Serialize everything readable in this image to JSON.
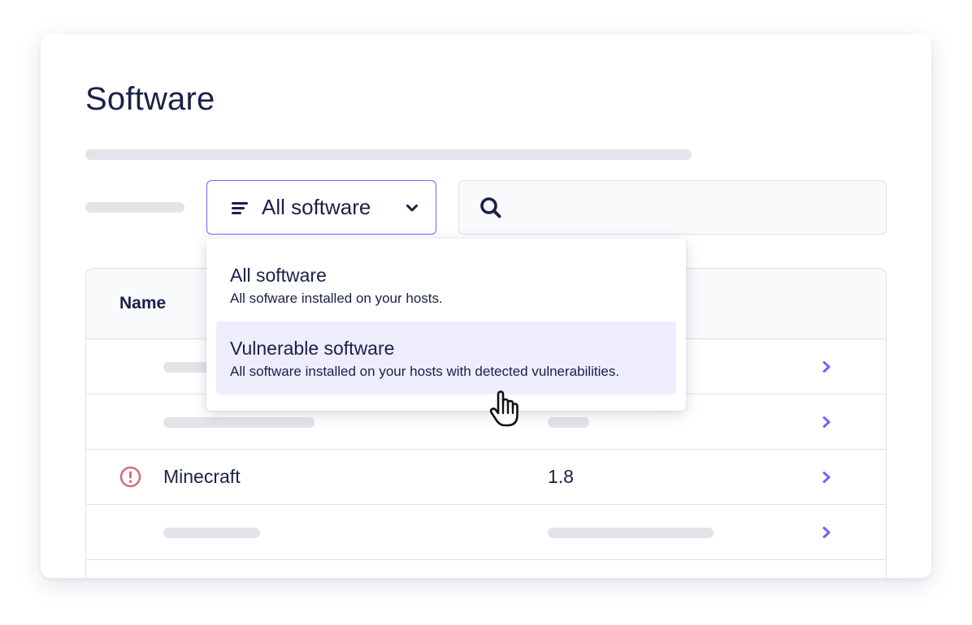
{
  "page": {
    "title": "Software"
  },
  "filter": {
    "selected_label": "All software"
  },
  "search": {
    "placeholder": ""
  },
  "table": {
    "header": {
      "name": "Name"
    },
    "rows": [
      {
        "name": "",
        "version": "",
        "placeholder": true,
        "vulnerable": false
      },
      {
        "name": "",
        "version": "",
        "placeholder": true,
        "vulnerable": false
      },
      {
        "name": "Minecraft",
        "version": "1.8",
        "placeholder": false,
        "vulnerable": true
      },
      {
        "name": "",
        "version": "",
        "placeholder": true,
        "vulnerable": false
      }
    ]
  },
  "dropdown": {
    "options": [
      {
        "title": "All software",
        "description": "All sofware installed on your hosts.",
        "highlighted": false
      },
      {
        "title": "Vulnerable software",
        "description": "All software installed on your hosts with detected vulnerabilities.",
        "highlighted": true
      }
    ]
  },
  "colors": {
    "accent": "#6a67fe",
    "text": "#192147",
    "danger": "#d66c7b",
    "highlight": "#eeedfb",
    "skeleton": "#e2e4ea"
  },
  "icons": [
    "filter-icon",
    "chevron-down-icon",
    "search-icon",
    "alert-icon",
    "chevron-right-icon",
    "pointer-cursor-icon"
  ]
}
